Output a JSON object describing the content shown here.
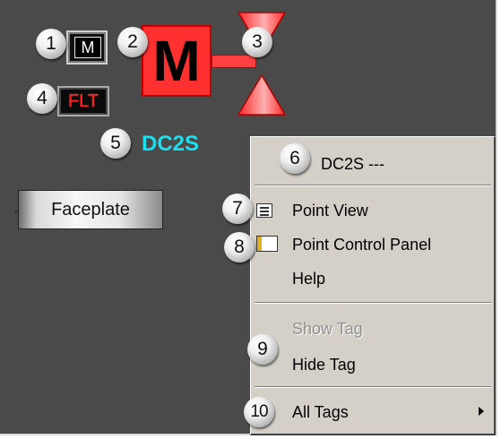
{
  "callouts": [
    "1",
    "2",
    "3",
    "4",
    "5",
    "6",
    "7",
    "8",
    "9",
    "10"
  ],
  "faceplate_buttons": {
    "mode_button_label": "M",
    "fault_indicator_label": "FLT",
    "motor_symbol_label": "M",
    "tag_name": "DC2S",
    "faceplate_button_label": "Faceplate"
  },
  "context_menu": {
    "header": "DC2S ---",
    "items": [
      {
        "label": "Point View",
        "icon": "point-view-icon",
        "enabled": true
      },
      {
        "label": "Point Control Panel",
        "icon": "control-panel-icon",
        "enabled": true
      },
      {
        "label": "Help",
        "icon": "",
        "enabled": true
      },
      {
        "label": "Show Tag",
        "icon": "",
        "enabled": false
      },
      {
        "label": "Hide Tag",
        "icon": "",
        "enabled": true
      },
      {
        "label": "All Tags",
        "icon": "submenu-arrow-icon",
        "enabled": true
      }
    ]
  },
  "colors": {
    "background": "#4a4a4a",
    "motor_red": "#ff3030",
    "tag_cyan": "#18e0f0",
    "fault_red": "#ff2020",
    "menu_face": "#d4d0c8"
  }
}
